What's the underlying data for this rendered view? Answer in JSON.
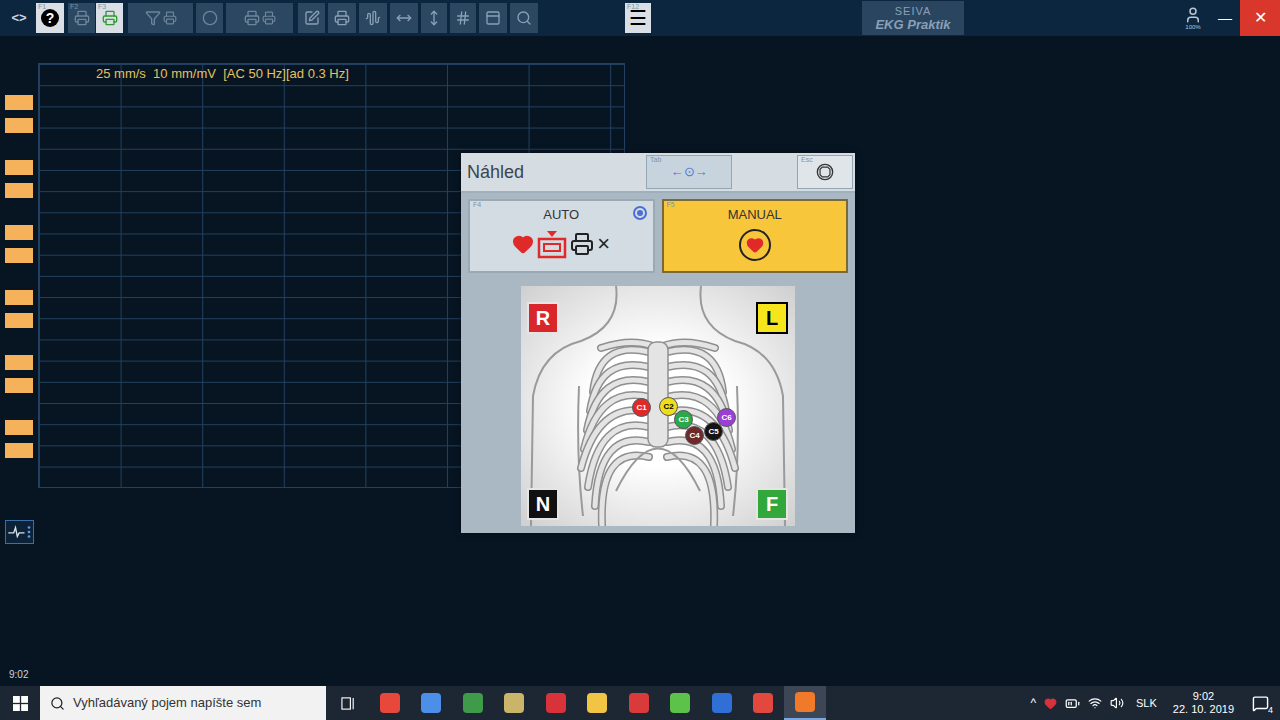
{
  "toolbar": {
    "nav": "<>",
    "buttons": [
      {
        "key": "F1",
        "label": "?",
        "disabled": false,
        "highlighted": true
      },
      {
        "key": "F2",
        "label": "",
        "disabled": true,
        "highlighted": false
      },
      {
        "key": "F3",
        "label": "",
        "disabled": false,
        "highlighted": true
      },
      {
        "key": "",
        "label": "",
        "disabled": true,
        "highlighted": false
      },
      {
        "key": "",
        "label": "",
        "disabled": true,
        "highlighted": false
      },
      {
        "key": "",
        "label": "",
        "disabled": true,
        "highlighted": false
      },
      {
        "key": "",
        "label": "",
        "disabled": false,
        "highlighted": false
      },
      {
        "key": "",
        "label": "",
        "disabled": false,
        "highlighted": false
      },
      {
        "key": "",
        "label": "",
        "disabled": false,
        "highlighted": false
      },
      {
        "key": "",
        "label": "",
        "disabled": false,
        "highlighted": false
      },
      {
        "key": "",
        "label": "",
        "disabled": false,
        "highlighted": false
      },
      {
        "key": "",
        "label": "",
        "disabled": false,
        "highlighted": false
      },
      {
        "key": "",
        "label": "",
        "disabled": false,
        "highlighted": false
      },
      {
        "key": "",
        "label": "",
        "disabled": false,
        "highlighted": false
      },
      {
        "key": "F12",
        "label": "☰",
        "disabled": false,
        "highlighted": true
      }
    ],
    "logo": {
      "line1": "SEIVA",
      "line2": "EKG Praktik"
    },
    "battery": "100%",
    "minimize": "—",
    "close": "✕"
  },
  "ecg": {
    "settings": "25 mm/s  10 mm/mV  [AC 50 Hz][ad 0.3 Hz]"
  },
  "clock_left": "9:02",
  "dialog": {
    "title": "Náhled",
    "nav_button": {
      "key": "Tab",
      "label": "←⊙→"
    },
    "stop_button": {
      "key": "Esc"
    },
    "modes": [
      {
        "label": "AUTO",
        "key": "F4",
        "selected": false,
        "default": true,
        "suffix": "×"
      },
      {
        "label": "MANUAL",
        "key": "F5",
        "selected": true,
        "default": false,
        "suffix": ""
      }
    ],
    "limb_electrodes": [
      {
        "label": "R",
        "color": "#d8262a"
      },
      {
        "label": "L",
        "color": "#f6e51c"
      },
      {
        "label": "N",
        "color": "#111111"
      },
      {
        "label": "F",
        "color": "#33a83a"
      }
    ],
    "chest_electrodes": [
      {
        "label": "C1",
        "color": "#e02a2a"
      },
      {
        "label": "C2",
        "color": "#f0dc1a"
      },
      {
        "label": "C3",
        "color": "#2aa84a"
      },
      {
        "label": "C4",
        "color": "#6e2a2a"
      },
      {
        "label": "C5",
        "color": "#141414"
      },
      {
        "label": "C6",
        "color": "#9a3fd4"
      }
    ]
  },
  "taskbar": {
    "search_placeholder": "Vyhľadávaný pojem napíšte sem",
    "apps": [
      {
        "color": "#e8473c",
        "active": false
      },
      {
        "color": "#4b8fe8",
        "active": false
      },
      {
        "color": "#3f9a4a",
        "active": false
      },
      {
        "color": "#c9b46a",
        "active": false
      },
      {
        "color": "#d8323a",
        "active": false
      },
      {
        "color": "#f2c445",
        "active": false
      },
      {
        "color": "#d93a3a",
        "active": false
      },
      {
        "color": "#5cc24a",
        "active": false
      },
      {
        "color": "#2f6fd6",
        "active": false
      },
      {
        "color": "#e2483e",
        "active": false
      },
      {
        "color": "#f07a2a",
        "active": true
      }
    ],
    "tray": {
      "expand": "^",
      "language": "SLK",
      "time": "9:02",
      "date": "22. 10. 2019",
      "notifications": "4"
    }
  }
}
